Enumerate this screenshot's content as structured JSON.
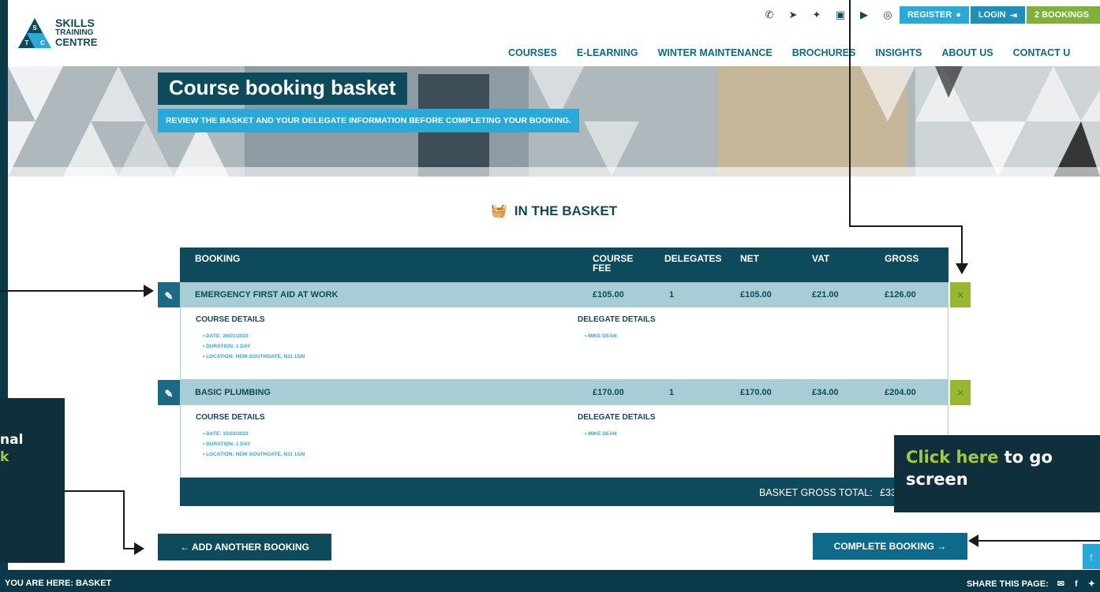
{
  "logo": {
    "word1": "SKILLS",
    "word2": "TRAINING",
    "word3": "CENTRE",
    "letters": [
      "S",
      "T",
      "C"
    ]
  },
  "topbar": {
    "social_icons": [
      "phone-icon",
      "paper-plane-icon",
      "twitter-icon",
      "linkedin-icon",
      "youtube-icon",
      "instagram-icon"
    ],
    "register_label": "REGISTER",
    "login_label": "LOGIN",
    "bookings_label": "2 BOOKINGS"
  },
  "nav": {
    "items": [
      "COURSES",
      "E-LEARNING",
      "WINTER MAINTENANCE",
      "BROCHURES",
      "INSIGHTS",
      "ABOUT US",
      "CONTACT U"
    ]
  },
  "hero": {
    "title": "Course booking basket",
    "subtitle": "REVIEW THE BASKET AND YOUR DELEGATE INFORMATION BEFORE COMPLETING YOUR BOOKING."
  },
  "basket": {
    "heading": "IN THE BASKET",
    "columns": {
      "booking": "BOOKING",
      "course_fee_1": "COURSE",
      "course_fee_2": "FEE",
      "delegates": "DELEGATES",
      "net": "NET",
      "vat": "VAT",
      "gross": "GROSS"
    },
    "rows": [
      {
        "name": "EMERGENCY FIRST AID AT WORK",
        "course_fee": "£105.00",
        "delegates": "1",
        "net": "£105.00",
        "vat": "£21.00",
        "gross": "£126.00",
        "course_details_label": "COURSE DETAILS",
        "delegate_details_label": "DELEGATE DETAILS",
        "date": "• DATE: 26/01/2023",
        "duration": "• DURATION: 1 DAY",
        "location": "• LOCATION: NEW SOUTHGATE, N11 1GN",
        "delegate": "• MIKE DEAN"
      },
      {
        "name": "BASIC PLUMBING",
        "course_fee": "£170.00",
        "delegates": "1",
        "net": "£170.00",
        "vat": "£34.00",
        "gross": "£204.00",
        "course_details_label": "COURSE DETAILS",
        "delegate_details_label": "DELEGATE DETAILS",
        "date": "• DATE: 15/03/2023",
        "duration": "• DURATION: 1 DAY",
        "location": "• LOCATION: NEW SOUTHGATE, N11 1GN",
        "delegate": "• MIKE DEAN"
      }
    ],
    "total_label": "BASKET GROSS TOTAL:",
    "total_value": "£33"
  },
  "buttons": {
    "add_another": "← ADD ANOTHER BOOKING",
    "complete": "COMPLETE BOOKING →",
    "scroll_top": "↑"
  },
  "footer": {
    "breadcrumb": "YOU ARE HERE: BASKET",
    "share_label": "SHARE THIS PAGE:",
    "share_icons": [
      "email-icon",
      "facebook-icon",
      "twitter-icon"
    ]
  },
  "tutorial": {
    "left_line1": "nal",
    "left_line2": "k",
    "right_highlight": "Click here",
    "right_text1": " to go",
    "right_text2": "screen"
  },
  "colors": {
    "dark_teal": "#0d4a5c",
    "accent_blue": "#2aa8d8",
    "accent_green": "#7fb03a",
    "row_bg": "#a9cdd4",
    "callout_bg": "#0f2f3c"
  }
}
